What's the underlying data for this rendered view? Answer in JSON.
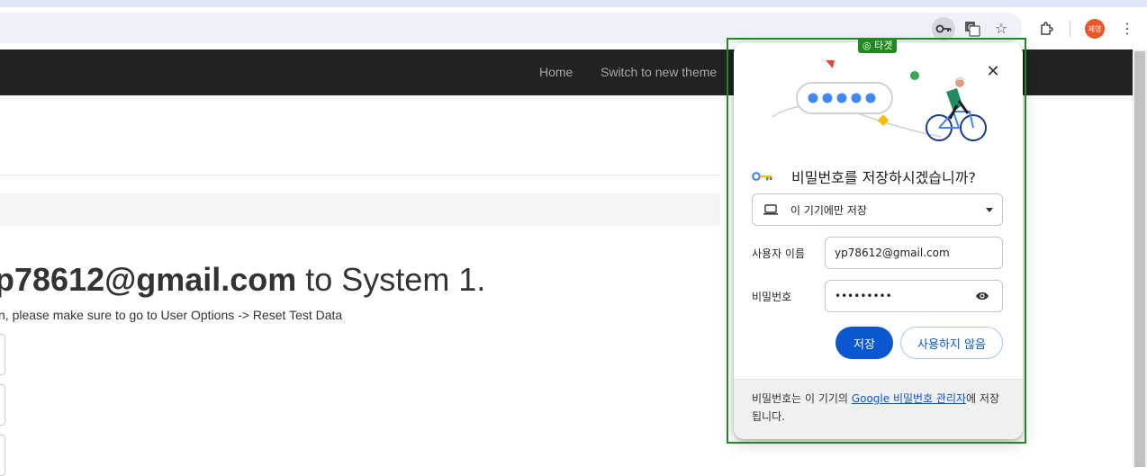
{
  "browser": {
    "profile_initials": "제영",
    "icons": [
      "password-key-icon",
      "translate-icon",
      "star-icon",
      "extensions-icon",
      "more-vert-icon"
    ]
  },
  "navbar": {
    "links": [
      "Home",
      "Switch to new theme"
    ]
  },
  "page": {
    "heading_bold": "p78612@gmail.com",
    "heading_rest": " to System 1.",
    "subtext": "n, please make sure to go to User Options -> Reset Test Data"
  },
  "target_tag": "◎ 타겟",
  "dialog": {
    "title": "비밀번호를 저장하시겠습니까?",
    "location_option": "이 기기에만 저장",
    "username_label": "사용자 이름",
    "username_value": "yp78612@gmail.com",
    "password_label": "비밀번호",
    "password_value": "•••••••••",
    "save_label": "저장",
    "never_label": "사용하지 않음",
    "footer_prefix": "비밀번호는 이 기기의 ",
    "footer_link": "Google 비밀번호 관리자",
    "footer_suffix": "에 저장됩니다.",
    "colors": {
      "primary": "#0b57d0",
      "target": "#1f8a1f"
    }
  }
}
